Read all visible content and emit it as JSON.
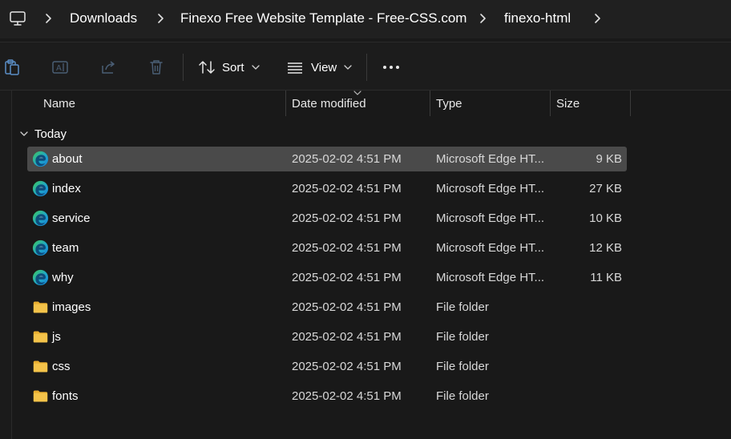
{
  "breadcrumb": {
    "items": [
      {
        "label": "Downloads"
      },
      {
        "label": "Finexo Free Website Template - Free-CSS.com"
      },
      {
        "label": "finexo-html"
      }
    ]
  },
  "toolbar": {
    "sort_label": "Sort",
    "view_label": "View"
  },
  "columns": {
    "name": "Name",
    "date": "Date modified",
    "type": "Type",
    "size": "Size"
  },
  "group": {
    "label": "Today"
  },
  "files": [
    {
      "name": "about",
      "date": "2025-02-02 4:51 PM",
      "type": "Microsoft Edge HT...",
      "size": "9 KB",
      "icon": "edge-icon",
      "selected": true
    },
    {
      "name": "index",
      "date": "2025-02-02 4:51 PM",
      "type": "Microsoft Edge HT...",
      "size": "27 KB",
      "icon": "edge-icon",
      "selected": false
    },
    {
      "name": "service",
      "date": "2025-02-02 4:51 PM",
      "type": "Microsoft Edge HT...",
      "size": "10 KB",
      "icon": "edge-icon",
      "selected": false
    },
    {
      "name": "team",
      "date": "2025-02-02 4:51 PM",
      "type": "Microsoft Edge HT...",
      "size": "12 KB",
      "icon": "edge-icon",
      "selected": false
    },
    {
      "name": "why",
      "date": "2025-02-02 4:51 PM",
      "type": "Microsoft Edge HT...",
      "size": "11 KB",
      "icon": "edge-icon",
      "selected": false
    },
    {
      "name": "images",
      "date": "2025-02-02 4:51 PM",
      "type": "File folder",
      "size": "",
      "icon": "folder-icon",
      "selected": false
    },
    {
      "name": "js",
      "date": "2025-02-02 4:51 PM",
      "type": "File folder",
      "size": "",
      "icon": "folder-icon",
      "selected": false
    },
    {
      "name": "css",
      "date": "2025-02-02 4:51 PM",
      "type": "File folder",
      "size": "",
      "icon": "folder-icon",
      "selected": false
    },
    {
      "name": "fonts",
      "date": "2025-02-02 4:51 PM",
      "type": "File folder",
      "size": "",
      "icon": "folder-icon",
      "selected": false
    }
  ],
  "colors": {
    "background": "#191919",
    "selection": "#4a4a4a",
    "folder": "#f4c34a",
    "edge_blue": "#1580d8",
    "edge_green": "#3fc85a"
  }
}
